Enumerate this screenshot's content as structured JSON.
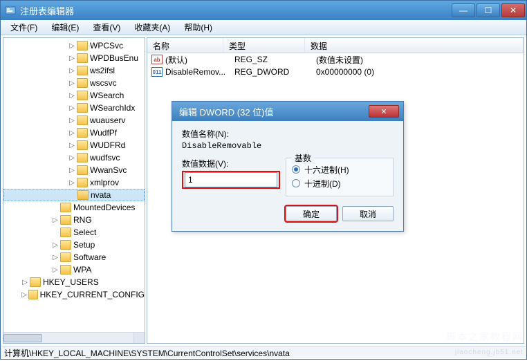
{
  "window": {
    "title": "注册表编辑器"
  },
  "menu": {
    "file": "文件(F)",
    "edit": "编辑(E)",
    "view": "查看(V)",
    "fav": "收藏夹(A)",
    "help": "帮助(H)"
  },
  "tree": {
    "indent_base": 92,
    "items": [
      {
        "label": "WPCSvc",
        "exp": "▷"
      },
      {
        "label": "WPDBusEnu",
        "exp": "▷"
      },
      {
        "label": "ws2ifsl",
        "exp": "▷"
      },
      {
        "label": "wscsvc",
        "exp": "▷"
      },
      {
        "label": "WSearch",
        "exp": "▷"
      },
      {
        "label": "WSearchIdx",
        "exp": "▷"
      },
      {
        "label": "wuauserv",
        "exp": "▷"
      },
      {
        "label": "WudfPf",
        "exp": "▷"
      },
      {
        "label": "WUDFRd",
        "exp": "▷"
      },
      {
        "label": "wudfsvc",
        "exp": "▷"
      },
      {
        "label": "WwanSvc",
        "exp": "▷"
      },
      {
        "label": "xmlprov",
        "exp": "▷"
      },
      {
        "label": "nvata",
        "exp": "",
        "sel": true
      }
    ],
    "tail": [
      {
        "label": "MountedDevices",
        "indent": 68,
        "exp": ""
      },
      {
        "label": "RNG",
        "indent": 68,
        "exp": "▷"
      },
      {
        "label": "Select",
        "indent": 68,
        "exp": ""
      },
      {
        "label": "Setup",
        "indent": 68,
        "exp": "▷"
      },
      {
        "label": "Software",
        "indent": 68,
        "exp": "▷"
      },
      {
        "label": "WPA",
        "indent": 68,
        "exp": "▷"
      },
      {
        "label": "HKEY_USERS",
        "indent": 24,
        "exp": "▷"
      },
      {
        "label": "HKEY_CURRENT_CONFIG",
        "indent": 24,
        "exp": "▷"
      }
    ]
  },
  "list": {
    "col_name": "名称",
    "col_type": "类型",
    "col_data": "数据",
    "rows": [
      {
        "icon": "ab",
        "name": "(默认)",
        "type": "REG_SZ",
        "data": "(数值未设置)"
      },
      {
        "icon": "dw",
        "name": "DisableRemov...",
        "type": "REG_DWORD",
        "data": "0x00000000 (0)"
      }
    ]
  },
  "dialog": {
    "title": "编辑 DWORD (32 位)值",
    "name_label": "数值名称(N):",
    "name_value": "DisableRemovable",
    "data_label": "数值数据(V):",
    "data_value": "1",
    "base_label": "基数",
    "hex": "十六进制(H)",
    "dec": "十进制(D)",
    "ok": "确定",
    "cancel": "取消"
  },
  "status": "计算机\\HKEY_LOCAL_MACHINE\\SYSTEM\\CurrentControlSet\\services\\nvata",
  "watermark": "脚本之家教程网",
  "watermark2": "jiaocheng.jb51.net"
}
